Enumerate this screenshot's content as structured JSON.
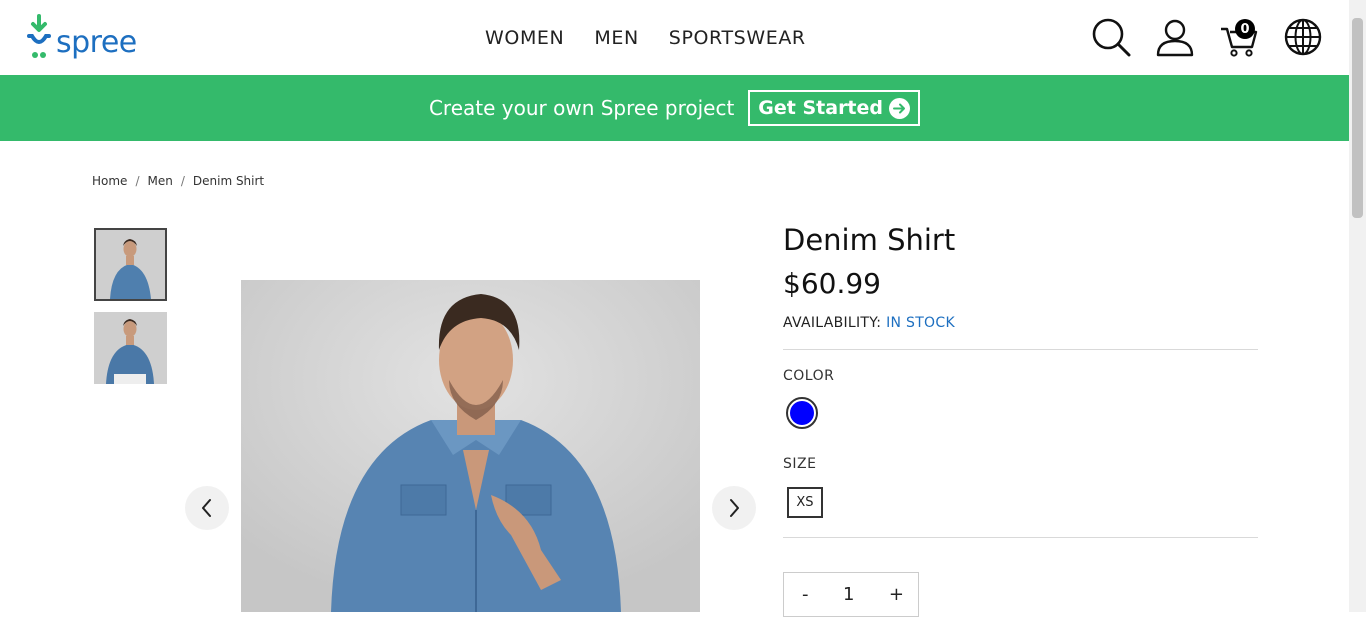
{
  "header": {
    "logo_text": "spree",
    "nav": [
      "WOMEN",
      "MEN",
      "SPORTSWEAR"
    ],
    "cart_count": "0",
    "icons": [
      "search-icon",
      "account-icon",
      "cart-icon",
      "globe-icon"
    ]
  },
  "promo": {
    "text": "Create your own Spree project",
    "button_label": "Get Started"
  },
  "breadcrumb": [
    "Home",
    "Men",
    "Denim Shirt"
  ],
  "product": {
    "title": "Denim Shirt",
    "price": "$60.99",
    "availability_label": "AVAILABILITY:",
    "availability_value": "IN STOCK",
    "color_label": "COLOR",
    "selected_color": "#0000ff",
    "size_label": "SIZE",
    "sizes": [
      "XS"
    ],
    "quantity": "1",
    "qty_minus": "-",
    "qty_plus": "+"
  },
  "colors": {
    "brand_green": "#34ba6b",
    "link_blue": "#1d6fc0"
  }
}
